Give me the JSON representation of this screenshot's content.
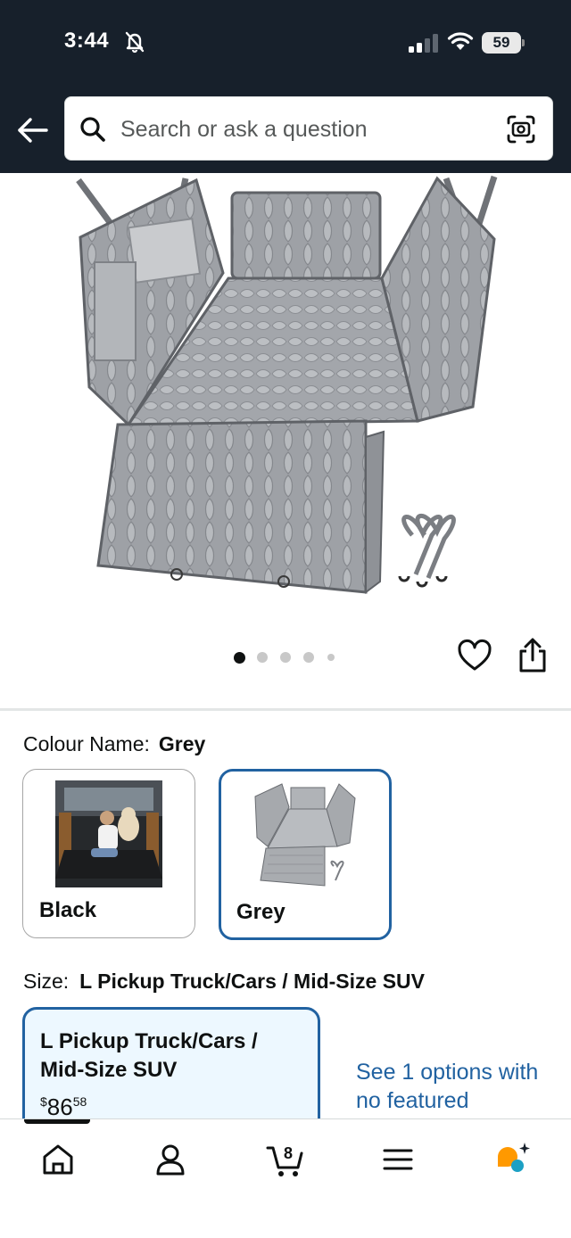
{
  "status_bar": {
    "time": "3:44",
    "battery": "59"
  },
  "search": {
    "placeholder": "Search or ask a question"
  },
  "icons": {
    "back": "back-arrow-icon",
    "search": "search-icon",
    "camera": "camera-scan-icon",
    "wishlist": "heart-icon",
    "share": "share-icon"
  },
  "carousel": {
    "total_images": 5,
    "active_index": 0
  },
  "colour": {
    "label": "Colour Name:",
    "selected": "Grey",
    "options": [
      {
        "label": "Black",
        "selected": false
      },
      {
        "label": "Grey",
        "selected": true
      }
    ]
  },
  "size": {
    "label": "Size:",
    "selected": "L Pickup Truck/Cars / Mid-Size SUV",
    "card": {
      "name": "L Pickup Truck/Cars / Mid-Size SUV",
      "price_symbol": "$",
      "price_whole": "86",
      "price_fraction": "58"
    },
    "see_options": "See 1 options with no featured"
  },
  "bottom_nav": {
    "items": [
      "home",
      "account",
      "cart",
      "menu",
      "rufus"
    ],
    "cart_count": "8",
    "accent": "#ff9900",
    "teal": "#1ca0c4"
  },
  "colors": {
    "header_bg": "#17202b",
    "link": "#2162a1",
    "selected_bg": "#edf8ff"
  }
}
